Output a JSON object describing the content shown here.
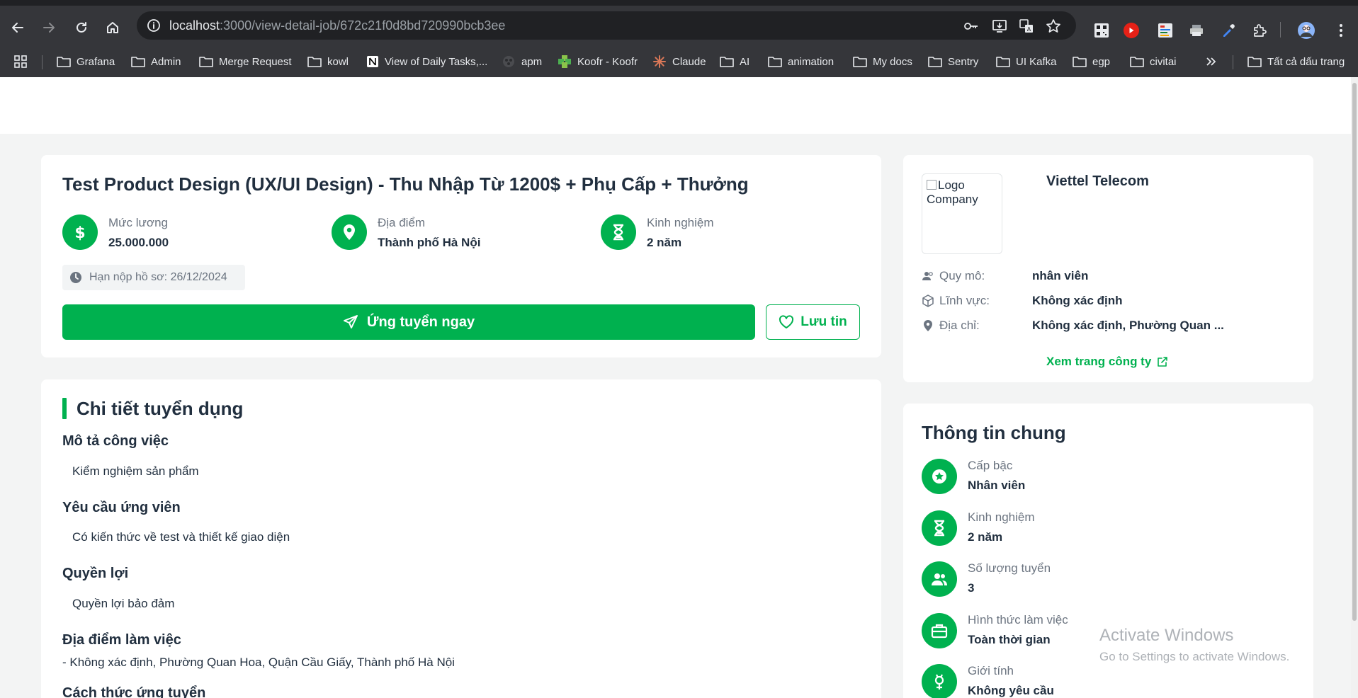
{
  "browser": {
    "url_host": "localhost",
    "url_path": ":3000/view-detail-job/672c21f0d8bd720990bcb3ee",
    "bookmarks": [
      {
        "label": "Grafana",
        "icon": "folder-icon"
      },
      {
        "label": "Admin",
        "icon": "folder-icon"
      },
      {
        "label": "Merge Request",
        "icon": "folder-icon"
      },
      {
        "label": "kowl",
        "icon": "folder-icon"
      },
      {
        "label": "View of Daily Tasks,...",
        "icon": "notion-icon"
      },
      {
        "label": "apm",
        "icon": "apm-icon"
      },
      {
        "label": "Koofr - Koofr",
        "icon": "koofr-icon"
      },
      {
        "label": "Claude",
        "icon": "claude-icon"
      },
      {
        "label": "AI",
        "icon": "folder-icon"
      },
      {
        "label": "animation",
        "icon": "folder-icon"
      },
      {
        "label": "My docs",
        "icon": "folder-icon"
      },
      {
        "label": "Sentry",
        "icon": "folder-icon"
      },
      {
        "label": "UI Kafka",
        "icon": "folder-icon"
      },
      {
        "label": "egp",
        "icon": "folder-icon"
      },
      {
        "label": "civitai",
        "icon": "folder-icon"
      }
    ],
    "all_bookmarks_label": "Tất cả dấu trang"
  },
  "job": {
    "title": "Test Product Design (UX/UI Design) - Thu Nhập Từ 1200$ + Phụ Cấp + Thưởng",
    "salary_label": "Mức lương",
    "salary_value": "25.000.000",
    "location_label": "Địa điểm",
    "location_value": "Thành phố Hà Nội",
    "experience_label": "Kinh nghiệm",
    "experience_value": "2 năm",
    "deadline": "Hạn nộp hồ sơ: 26/12/2024",
    "apply_label": "Ứng tuyển ngay",
    "save_label": "Lưu tin"
  },
  "details": {
    "heading": "Chi tiết tuyển dụng",
    "sections": [
      {
        "title": "Mô tả công việc",
        "text": "Kiểm nghiệm sản phẩm"
      },
      {
        "title": "Yêu cầu ứng viên",
        "text": "Có kiến thức về test và thiết kế giao diện"
      },
      {
        "title": "Quyền lợi",
        "text": "Quyền lợi bảo đảm"
      },
      {
        "title": "Địa điểm làm việc",
        "text": "- Không xác định, Phường Quan Hoa, Quận Cầu Giấy, Thành phố Hà Nội"
      },
      {
        "title": "Cách thức ứng tuyển",
        "text": ""
      }
    ]
  },
  "company": {
    "logo_alt": "Logo Company",
    "name": "Viettel Telecom",
    "size_label": "Quy mô:",
    "size_value": "nhân viên",
    "field_label": "Lĩnh vực:",
    "field_value": "Không xác định",
    "address_label": "Địa chỉ:",
    "address_value": "Không xác định, Phường Quan ...",
    "link_label": "Xem trang công ty"
  },
  "general": {
    "heading": "Thông tin chung",
    "items": [
      {
        "label": "Cấp bậc",
        "value": "Nhân viên",
        "icon": "star-badge-icon"
      },
      {
        "label": "Kinh nghiệm",
        "value": "2 năm",
        "icon": "hourglass-icon"
      },
      {
        "label": "Số lượng tuyển",
        "value": "3",
        "icon": "people-icon"
      },
      {
        "label": "Hình thức làm việc",
        "value": "Toàn thời gian",
        "icon": "briefcase-icon"
      },
      {
        "label": "Giới tính",
        "value": "Không yêu cầu",
        "icon": "gender-icon"
      }
    ]
  },
  "watermark": {
    "line1": "Activate Windows",
    "line2": "Go to Settings to activate Windows."
  },
  "colors": {
    "accent": "#00b14f",
    "chrome_dark": "#35363a",
    "page_bg": "#f3f4f4"
  }
}
